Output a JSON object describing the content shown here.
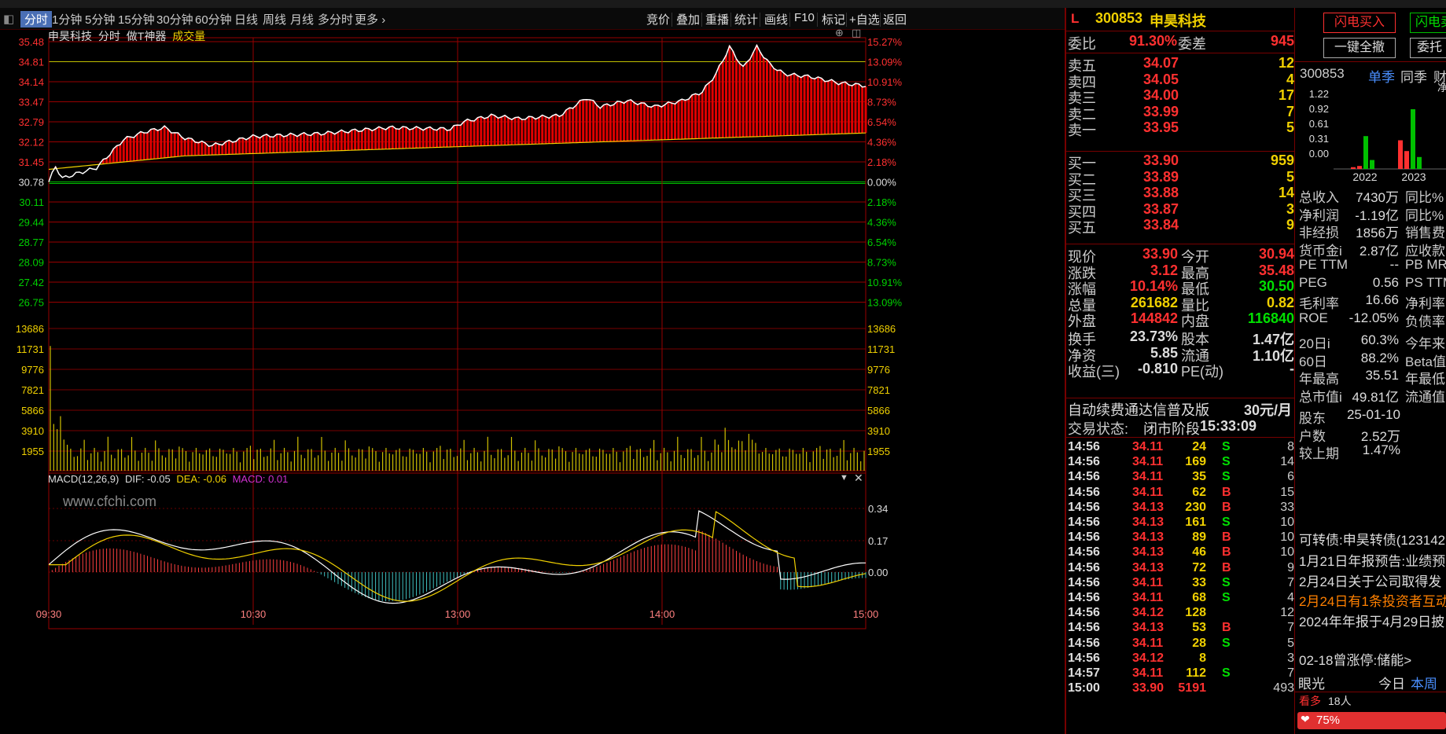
{
  "tabs": [
    "分时",
    "1分钟",
    "5分钟",
    "15分钟",
    "30分钟",
    "60分钟",
    "日线",
    "周线",
    "月线",
    "多分时",
    "更多"
  ],
  "right_tabs": [
    "竞价",
    "叠加",
    "重播",
    "统计",
    "画线",
    "F10",
    "标记",
    "+自选",
    "返回"
  ],
  "chart_header": {
    "name": "申昊科技",
    "mode": "分时",
    "tool": "做T神器",
    "volume_label": "成交量"
  },
  "price_axis_left": [
    "35.48",
    "34.81",
    "34.14",
    "33.47",
    "32.79",
    "32.12",
    "31.45",
    "30.78",
    "30.11",
    "29.44",
    "28.77",
    "28.09",
    "27.42",
    "26.75"
  ],
  "price_axis_right": [
    "15.27%",
    "13.09%",
    "10.91%",
    "8.73%",
    "6.54%",
    "4.36%",
    "2.18%",
    "0.00%",
    "2.18%",
    "4.36%",
    "6.54%",
    "8.73%",
    "10.91%",
    "13.09%"
  ],
  "volume_axis": [
    "13686",
    "11731",
    "9776",
    "7821",
    "5866",
    "3910",
    "1955"
  ],
  "macd_label": {
    "name": "MACD(12,26,9)",
    "dif": "DIF: -0.05",
    "dea": "DEA: -0.06",
    "macd": "MACD: 0.01"
  },
  "macd_axis": [
    "0.34",
    "0.17",
    "0.00"
  ],
  "watermark": "www.cfchi.com",
  "time_axis": [
    "09:30",
    "10:30",
    "13:00",
    "14:00",
    "15:00"
  ],
  "stock": {
    "flag": "L",
    "code": "300853",
    "name": "申昊科技"
  },
  "weibi": {
    "label": "委比",
    "value": "91.30%",
    "diff_label": "委差",
    "diff": "945"
  },
  "asks": [
    {
      "label": "卖五",
      "price": "34.07",
      "vol": "12"
    },
    {
      "label": "卖四",
      "price": "34.05",
      "vol": "4"
    },
    {
      "label": "卖三",
      "price": "34.00",
      "vol": "17"
    },
    {
      "label": "卖二",
      "price": "33.99",
      "vol": "7"
    },
    {
      "label": "卖一",
      "price": "33.95",
      "vol": "5"
    }
  ],
  "bids": [
    {
      "label": "买一",
      "price": "33.90",
      "vol": "959"
    },
    {
      "label": "买二",
      "price": "33.89",
      "vol": "5"
    },
    {
      "label": "买三",
      "price": "33.88",
      "vol": "14"
    },
    {
      "label": "买四",
      "price": "33.87",
      "vol": "3"
    },
    {
      "label": "买五",
      "price": "33.84",
      "vol": "9"
    }
  ],
  "quote": [
    {
      "l1": "现价",
      "v1": "33.90",
      "c1": "red",
      "l2": "今开",
      "v2": "30.94",
      "c2": "red"
    },
    {
      "l1": "涨跌",
      "v1": "3.12",
      "c1": "red",
      "l2": "最高",
      "v2": "35.48",
      "c2": "red"
    },
    {
      "l1": "涨幅",
      "v1": "10.14%",
      "c1": "red",
      "l2": "最低",
      "v2": "30.50",
      "c2": "green"
    },
    {
      "l1": "总量",
      "v1": "261682",
      "c1": "yellow",
      "l2": "量比",
      "v2": "0.82",
      "c2": "yellow"
    },
    {
      "l1": "外盘",
      "v1": "144842",
      "c1": "red",
      "l2": "内盘",
      "v2": "116840",
      "c2": "green"
    },
    {
      "l1": "换手",
      "v1": "23.73%",
      "c1": "white",
      "l2": "股本",
      "v2": "1.47亿",
      "c2": "white"
    },
    {
      "l1": "净资",
      "v1": "5.85",
      "c1": "white",
      "l2": "流通",
      "v2": "1.10亿",
      "c2": "white"
    },
    {
      "l1": "收益(三)",
      "v1": "-0.810",
      "c1": "white",
      "l2": "PE(动)",
      "v2": "-",
      "c2": "white"
    }
  ],
  "promo": {
    "text": "自动续费通达信普及版",
    "price": "30元/月"
  },
  "trade_status": {
    "label": "交易状态:",
    "value": "闭市阶段",
    "time": "15:33:09"
  },
  "trades": [
    {
      "t": "14:56",
      "p": "34.11",
      "v": "24",
      "bs": "S",
      "n": "8"
    },
    {
      "t": "14:56",
      "p": "34.11",
      "v": "169",
      "bs": "S",
      "n": "14"
    },
    {
      "t": "14:56",
      "p": "34.11",
      "v": "35",
      "bs": "S",
      "n": "6"
    },
    {
      "t": "14:56",
      "p": "34.11",
      "v": "62",
      "bs": "B",
      "n": "15"
    },
    {
      "t": "14:56",
      "p": "34.13",
      "v": "230",
      "bs": "B",
      "n": "33"
    },
    {
      "t": "14:56",
      "p": "34.13",
      "v": "161",
      "bs": "S",
      "n": "10"
    },
    {
      "t": "14:56",
      "p": "34.13",
      "v": "89",
      "bs": "B",
      "n": "10"
    },
    {
      "t": "14:56",
      "p": "34.13",
      "v": "46",
      "bs": "B",
      "n": "10"
    },
    {
      "t": "14:56",
      "p": "34.13",
      "v": "72",
      "bs": "B",
      "n": "9"
    },
    {
      "t": "14:56",
      "p": "34.11",
      "v": "33",
      "bs": "S",
      "n": "7"
    },
    {
      "t": "14:56",
      "p": "34.11",
      "v": "68",
      "bs": "S",
      "n": "4"
    },
    {
      "t": "14:56",
      "p": "34.12",
      "v": "128",
      "bs": "",
      "n": "12"
    },
    {
      "t": "14:56",
      "p": "34.13",
      "v": "53",
      "bs": "B",
      "n": "7"
    },
    {
      "t": "14:56",
      "p": "34.11",
      "v": "28",
      "bs": "S",
      "n": "5"
    },
    {
      "t": "14:56",
      "p": "34.12",
      "v": "8",
      "bs": "",
      "n": "3"
    },
    {
      "t": "14:57",
      "p": "34.11",
      "v": "112",
      "bs": "S",
      "n": "7"
    },
    {
      "t": "15:00",
      "p": "33.90",
      "v": "5191",
      "bs": "",
      "n": "493"
    }
  ],
  "side": {
    "btn_flash": "闪电买入",
    "btn_flash2": "闪电卖",
    "btn_cancel": "一键全撤",
    "btn_entrust": "委托",
    "code": "300853",
    "tab1": "单季",
    "tab2": "同季",
    "tab3": "财",
    "chart_y": [
      "1.22",
      "0.92",
      "0.61",
      "0.31",
      "0.00"
    ],
    "chart_x": [
      "2022",
      "2023"
    ],
    "chart_extra": "净",
    "rows": [
      {
        "l": "总收入",
        "v": "7430万",
        "r": "同比%"
      },
      {
        "l": "净利润",
        "v": "-1.19亿",
        "r": "同比%"
      },
      {
        "l": "非经损",
        "v": "1856万",
        "r": "销售费"
      },
      {
        "l": "货币金i",
        "v": "2.87亿",
        "r": "应收款"
      },
      {
        "l": "PE TTM",
        "v": "--",
        "r": "PB MRQ"
      },
      {
        "l": "PEG",
        "v": "0.56",
        "r": "PS TTM"
      },
      {
        "l": "毛利率",
        "v": "16.66",
        "r": "净利率"
      },
      {
        "l": "ROE",
        "v": "-12.05%",
        "r": "负债率"
      },
      {
        "l": "20日i",
        "v": "60.3%",
        "r": "今年来"
      },
      {
        "l": "60日",
        "v": "88.2%",
        "r": "Beta值"
      },
      {
        "l": "年最高",
        "v": "35.51",
        "r": "年最低"
      },
      {
        "l": "总市值i",
        "v": "49.81亿",
        "r": "流通值"
      },
      {
        "l": "股东",
        "v": "25-01-10",
        "r": ""
      },
      {
        "l": "户数",
        "v": "2.52万",
        "r": ""
      },
      {
        "l": "较上期",
        "v": "1.47%",
        "r": ""
      }
    ],
    "news": [
      "可转债:申昊转债(123142",
      "1月21日年报预告:业绩预",
      "2月24日关于公司取得发",
      "2月24日有1条投资者互动",
      "2024年年报于4月29日披",
      "02-18曾涨停:储能>"
    ],
    "eyelight": {
      "label": "眼光",
      "today": "今日",
      "week": "本周",
      "bull": "看多",
      "count": "18人",
      "pct": "75%"
    }
  }
}
